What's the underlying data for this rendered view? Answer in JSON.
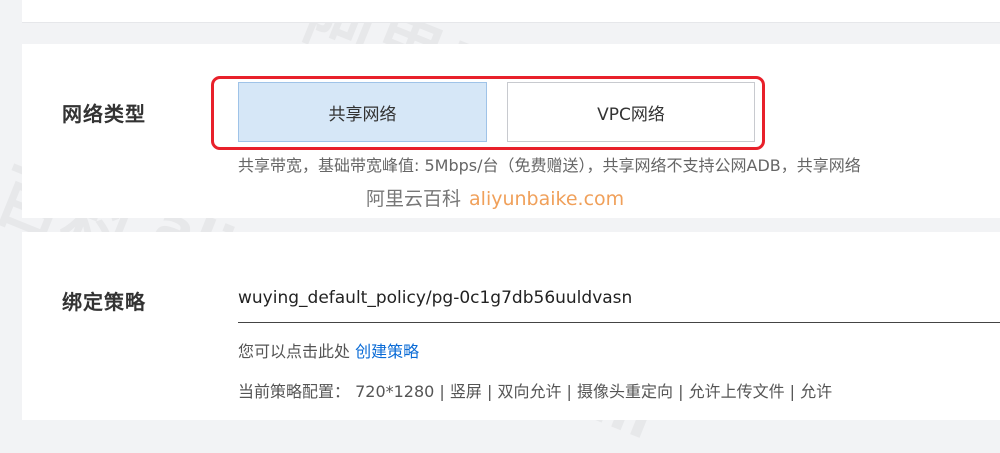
{
  "network": {
    "label": "网络类型",
    "options": [
      {
        "label": "共享网络",
        "selected": true
      },
      {
        "label": "VPC网络",
        "selected": false
      }
    ],
    "hint": "共享带宽，基础带宽峰值: 5Mbps/台（免费赠送），共享网络不支持公网ADB，共享网络"
  },
  "watermark": {
    "cn": "阿里云百科",
    "url": "aliyunbaike.com",
    "bg_cn_1": "阿里云百科",
    "bg_cn_2": "百科",
    "bg_url": "aliyunbaike.com",
    "bg_url_2": "aliyunb"
  },
  "policy": {
    "label": "绑定策略",
    "value": "wuying_default_policy/pg-0c1g7db56uuldvasn",
    "hint_prefix": "您可以点击此处",
    "hint_link": "创建策略",
    "config": "当前策略配置：  720*1280  |  竖屏  |  双向允许  |  摄像头重定向  |  允许上传文件  |  允许"
  },
  "colors": {
    "accent": "#0a6bd6",
    "highlight": "#e8202a",
    "selected_bg": "#d6e7f7",
    "watermark_url": "#f0a05a"
  }
}
